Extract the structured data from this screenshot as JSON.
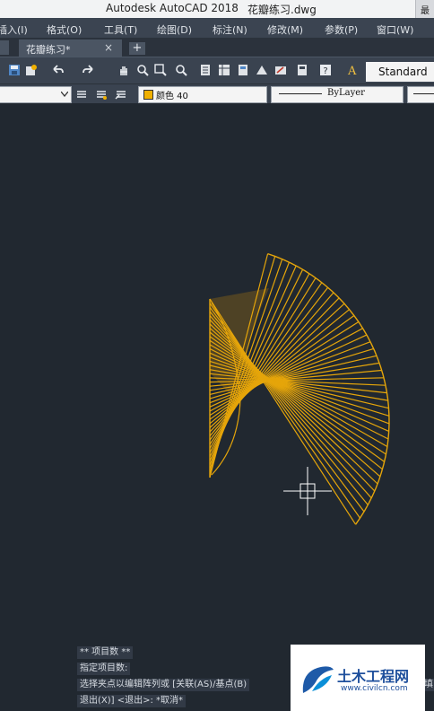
{
  "titlebar": {
    "app_name": "Autodesk AutoCAD 2018",
    "file_name": "花瓣练习.dwg",
    "corner_button": "最"
  },
  "menubar": {
    "items": [
      "插入(I)",
      "格式(O)",
      "工具(T)",
      "绘图(D)",
      "标注(N)",
      "修改(M)",
      "参数(P)",
      "窗口(W)"
    ]
  },
  "tabs": {
    "active_tab_label": "花瓣练习*",
    "close_symbol": "×",
    "new_tab_symbol": "+"
  },
  "toolbar": {
    "text_style_value": "Standard",
    "color_value": "颜色 40",
    "linetype_value": "ByLayer"
  },
  "colors": {
    "petal_lines": "#e5a50a",
    "petal_fill": "#d98e04",
    "color_swatch": "#f0b000"
  },
  "drawing": {
    "petal_line_count": 44
  },
  "command": {
    "line1": "** 项目数 **",
    "line2": "指定项目数:",
    "line3": "选择夹点以编辑阵列或 [关联(AS)/基点(B)",
    "line3_tail": "填",
    "line4": "退出(X)] <退出>: *取消*"
  },
  "watermark": {
    "brand": "土木工程网",
    "url": "www.civilcn.com"
  }
}
